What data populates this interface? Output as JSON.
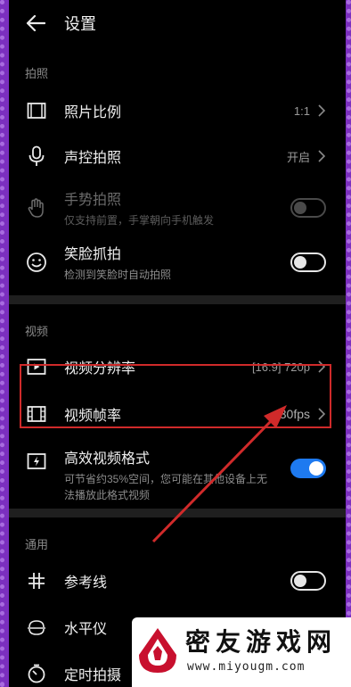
{
  "topbar": {
    "title": "设置"
  },
  "photo_section": {
    "title": "拍照",
    "aspect_ratio": {
      "label": "照片比例",
      "value": "1:1"
    },
    "voice_capture": {
      "label": "声控拍照",
      "value": "开启"
    },
    "gesture_capture": {
      "label": "手势拍照",
      "sub": "仅支持前置，手掌朝向手机触发",
      "enabled": false,
      "state": "off"
    },
    "smile_capture": {
      "label": "笑脸抓拍",
      "sub": "检测到笑脸时自动拍照",
      "state": "off"
    }
  },
  "video_section": {
    "title": "视频",
    "resolution": {
      "label": "视频分辨率",
      "value": "[16:9] 720p"
    },
    "frame_rate": {
      "label": "视频帧率",
      "value": "30fps"
    },
    "efficient_format": {
      "label": "高效视频格式",
      "sub": "可节省约35%空间，您可能在其他设备上无法播放此格式视频",
      "state": "on"
    }
  },
  "general_section": {
    "title": "通用",
    "grid_lines": {
      "label": "参考线",
      "state": "off"
    },
    "level": {
      "label": "水平仪",
      "state": "off"
    },
    "timer": {
      "label": "定时拍摄"
    }
  },
  "watermark": {
    "title": "密友游戏网",
    "url": "www.miyougm.com"
  },
  "colors": {
    "accent": "#1e7af0",
    "highlight": "#d02a2a",
    "frame": "#7b2fbf"
  }
}
